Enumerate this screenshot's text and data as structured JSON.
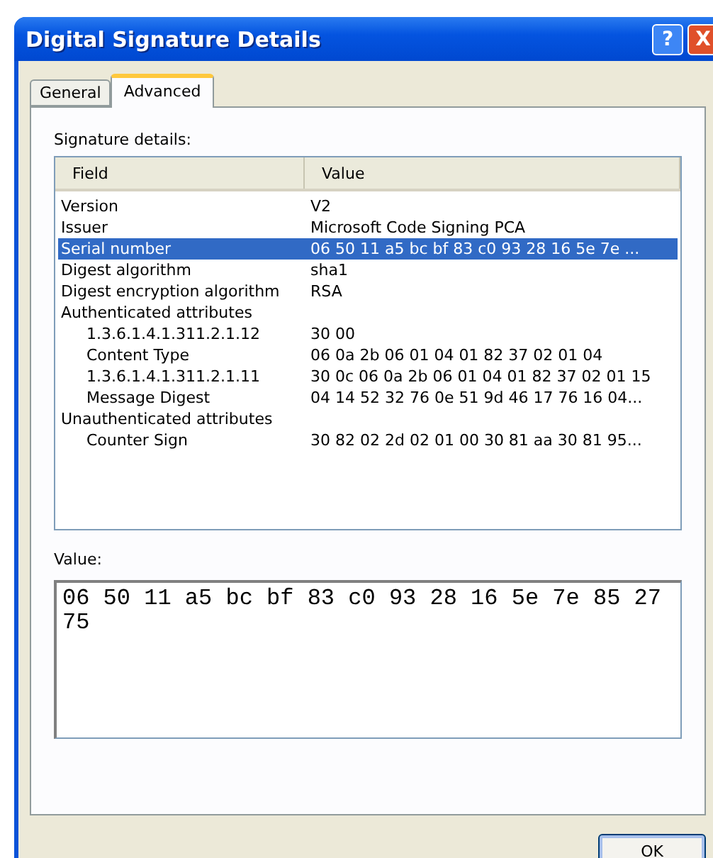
{
  "window": {
    "title": "Digital Signature Details"
  },
  "title_buttons": [
    "?",
    "X"
  ],
  "tabs": [
    {
      "label": "General",
      "selected": false
    },
    {
      "label": "Advanced",
      "selected": true
    }
  ],
  "details_label": "Signature details:",
  "table": {
    "columns": [
      "Field",
      "Value"
    ],
    "rows": [
      {
        "field": "Version",
        "value": "V2",
        "selected": false
      },
      {
        "field": "Issuer",
        "value": "Microsoft Code Signing PCA",
        "selected": false
      },
      {
        "field": "Serial number",
        "value": "06 50 11 a5 bc bf 83 c0 93 28 16 5e 7e ...",
        "selected": true
      },
      {
        "field": "Digest algorithm",
        "value": "sha1",
        "selected": false
      },
      {
        "field": "Digest encryption algorithm",
        "value": "RSA",
        "selected": false
      },
      {
        "field": "Authenticated attributes",
        "selected": false,
        "children": [
          {
            "field": "1.3.6.1.4.1.311.2.1.12",
            "value": "30 00",
            "selected": false
          },
          {
            "field": "Content Type",
            "value": "06 0a 2b 06 01 04 01 82 37 02 01 04",
            "selected": false
          },
          {
            "field": "1.3.6.1.4.1.311.2.1.11",
            "value": "30 0c 06 0a 2b 06 01 04 01 82 37 02 01 15",
            "selected": false
          },
          {
            "field": "Message Digest",
            "value": "04 14 52 32 76 0e 51 9d 46 17 76 16 04...",
            "selected": false
          }
        ]
      },
      {
        "field": "Unauthenticated attributes",
        "selected": false,
        "children": [
          {
            "field": "Counter Sign",
            "value": "30 82 02 2d 02 01 00 30 81 aa 30 81 95...",
            "selected": false
          }
        ]
      }
    ]
  },
  "value_label": "Value:",
  "value_text": "06 50 11 a5 bc bf 83 c0 93 28 16 5e 7e 85 27 75",
  "ok_button": "OK"
}
